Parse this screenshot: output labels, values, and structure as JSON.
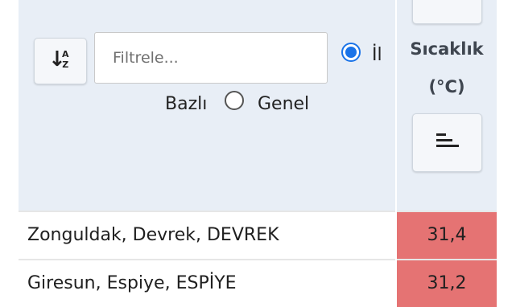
{
  "toolbar": {
    "sort_icon": "sort-alpha-asc-icon",
    "sort_letters_top": "A",
    "sort_letters_bottom": "Z"
  },
  "filter": {
    "placeholder": "Filtrele...",
    "value": ""
  },
  "scope": {
    "option_il_label": "İl",
    "option_il_suffix": "Bazlı",
    "option_genel_label": "Genel",
    "selected": "il"
  },
  "column": {
    "title": "Sıcaklık",
    "unit": "(°C)",
    "sort_icon": "sort-bars-icon"
  },
  "rows": [
    {
      "location": "Zonguldak, Devrek, DEVREK",
      "temperature": "31,4"
    },
    {
      "location": "Giresun, Espiye, ESPİYE",
      "temperature": "31,2"
    }
  ],
  "colors": {
    "header_background": "#e8eef6",
    "hot_cell": "#e57373",
    "radio_selected": "#1a73e8"
  }
}
